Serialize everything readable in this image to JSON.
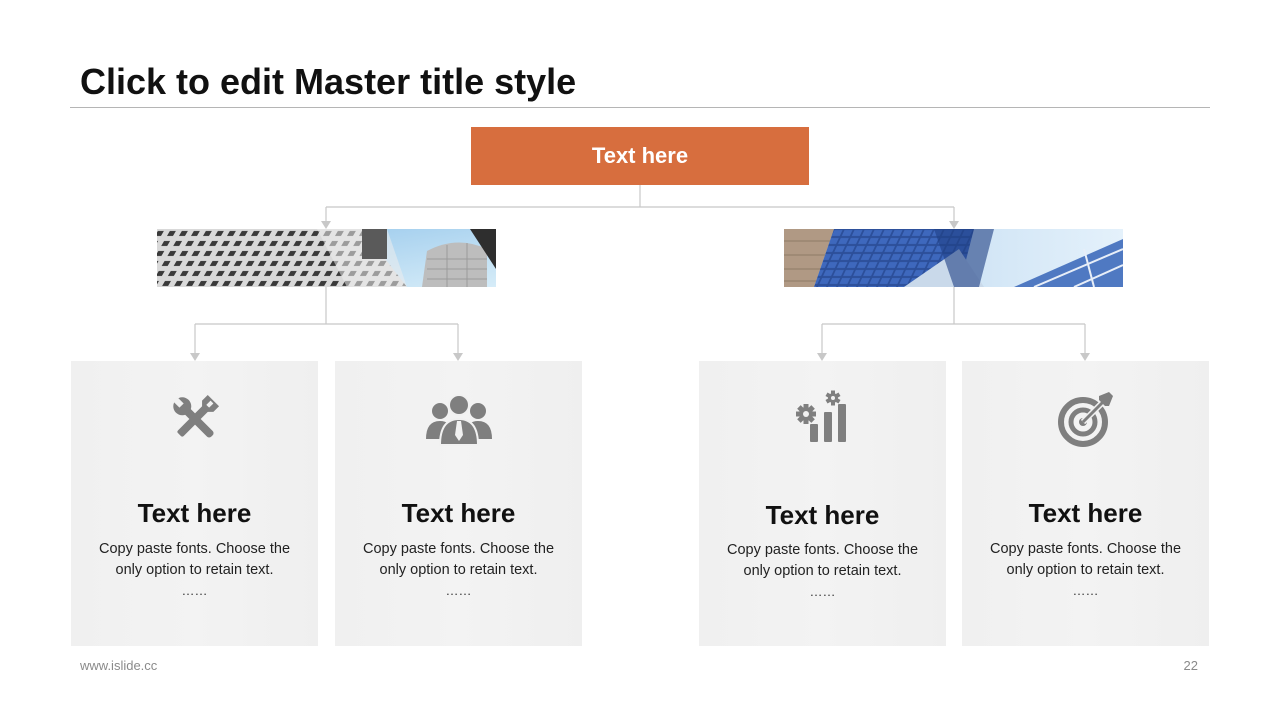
{
  "title": "Click to edit Master title style",
  "root": {
    "label": "Text here"
  },
  "cards": [
    {
      "heading": "Text here",
      "line1": "Copy paste fonts. Choose the",
      "line2": "only option to retain text.",
      "dots": "……",
      "icon": "tools-icon"
    },
    {
      "heading": "Text here",
      "line1": "Copy paste fonts. Choose the",
      "line2": "only option to retain text.",
      "dots": "……",
      "icon": "team-icon"
    },
    {
      "heading": "Text here",
      "line1": "Copy paste fonts. Choose the",
      "line2": "only option to retain text.",
      "dots": "……",
      "icon": "gear-chart-icon"
    },
    {
      "heading": "Text here",
      "line1": "Copy paste fonts. Choose the",
      "line2": "only option to retain text.",
      "dots": "……",
      "icon": "target-icon"
    }
  ],
  "footer": {
    "url": "www.islide.cc",
    "page": "22"
  },
  "colors": {
    "accent": "#d76e3e",
    "card_bg": "#f1f1f1",
    "icon": "#7f7f7f",
    "connector": "#c8c8c8"
  }
}
